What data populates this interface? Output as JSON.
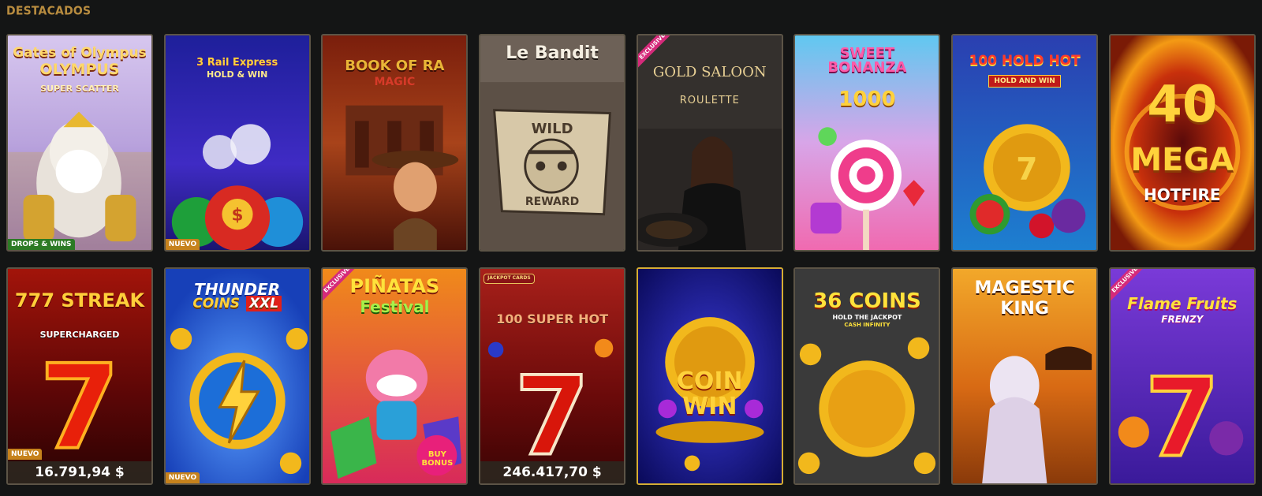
{
  "section": {
    "title": "DESTACADOS"
  },
  "games": [
    {
      "title": "Gates of Olympus",
      "subtitle": "Super Scatter",
      "badge": "DROPS & WINS"
    },
    {
      "title": "3 Rail Express",
      "subtitle": "HOLD & WIN",
      "badge": "NUEVO"
    },
    {
      "title": "BOOK OF RA",
      "subtitle": "MAGIC"
    },
    {
      "title": "Le Bandit",
      "sign_top": "WILD",
      "sign_bottom": "REWARD"
    },
    {
      "title": "GOLD SALOON",
      "subtitle": "ROULETTE",
      "ribbon": "EXCLUSIVE"
    },
    {
      "title": "SWEET BONANZA",
      "subtitle": "1000"
    },
    {
      "title": "100 HOLD HOT",
      "subtitle": "HOLD AND WIN"
    },
    {
      "title": "40",
      "subtitle": "MEGA",
      "tagline": "HOTFIRE"
    },
    {
      "title": "777 STREAK",
      "subtitle": "SUPERCHARGED",
      "badge": "NUEVO",
      "jackpot_amount": "16.791,94 $"
    },
    {
      "title": "THUNDER",
      "subtitle": "COINS",
      "tag": "XXL",
      "badge": "NUEVO"
    },
    {
      "title": "PIÑATAS",
      "subtitle": "Festival",
      "ribbon": "EXCLUSIVE",
      "bonus": "BUY BONUS"
    },
    {
      "title": "100 SUPER HOT",
      "logo": "JACKPOT CARDS",
      "jackpot_amount": "246.417,70 $"
    },
    {
      "title": "COIN",
      "subtitle": "WIN"
    },
    {
      "title": "36 COINS",
      "subtitle": "HOLD THE JACKPOT",
      "tagline": "CASH INFINITY"
    },
    {
      "title": "MAGESTIC",
      "subtitle": "KING"
    },
    {
      "title": "Flame Fruits",
      "subtitle": "FRENZY",
      "ribbon": "EXCLUSIVE"
    }
  ],
  "colors": {
    "background": "#141515",
    "section_title": "#b88c3f",
    "tile_border": "#5c5446",
    "tile_highlight": "#d6ad34",
    "badge_green": "#2c7a24",
    "badge_orange": "#c6821c",
    "ribbon_pink": "#d52a7a"
  }
}
